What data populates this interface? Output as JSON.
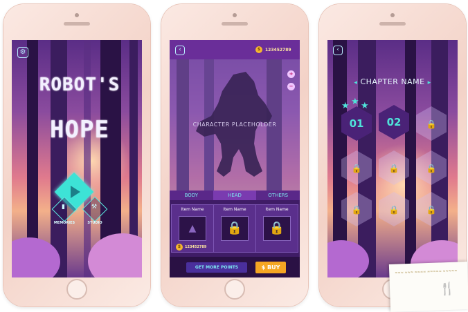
{
  "screen1": {
    "title_line1": "ROBOT'S",
    "title_line2": "HOPE",
    "memories_label": "MEMORIES",
    "studio_label": "STUDIO"
  },
  "screen2": {
    "coin_balance": "123452789",
    "placeholder": "CHARACTER PLACEHOLDER",
    "tabs": [
      "BODY",
      "HEAD",
      "OTHERS"
    ],
    "active_tab": "HEAD",
    "items": [
      {
        "name": "Item Name",
        "price": "123452789"
      },
      {
        "name": "Item Name"
      },
      {
        "name": "Item Name"
      }
    ],
    "more_points_label": "GET MORE POINTS",
    "buy_label": "BUY"
  },
  "screen3": {
    "chapter_name": "CHAPTER NAME",
    "unlocked_levels": [
      "01",
      "02"
    ],
    "stars": 3
  },
  "colors": {
    "accent": "#4fe3da",
    "buy": "#f5a623",
    "panel": "#3f1c66",
    "coin": "#f5b731"
  },
  "icons": {
    "settings": "gear-icon",
    "back": "back-arrow-icon",
    "lock": "lock-icon",
    "star": "star-icon",
    "coin": "coin-icon",
    "zoom_in": "zoom-in-icon",
    "zoom_out": "zoom-out-icon",
    "play": "play-icon"
  }
}
